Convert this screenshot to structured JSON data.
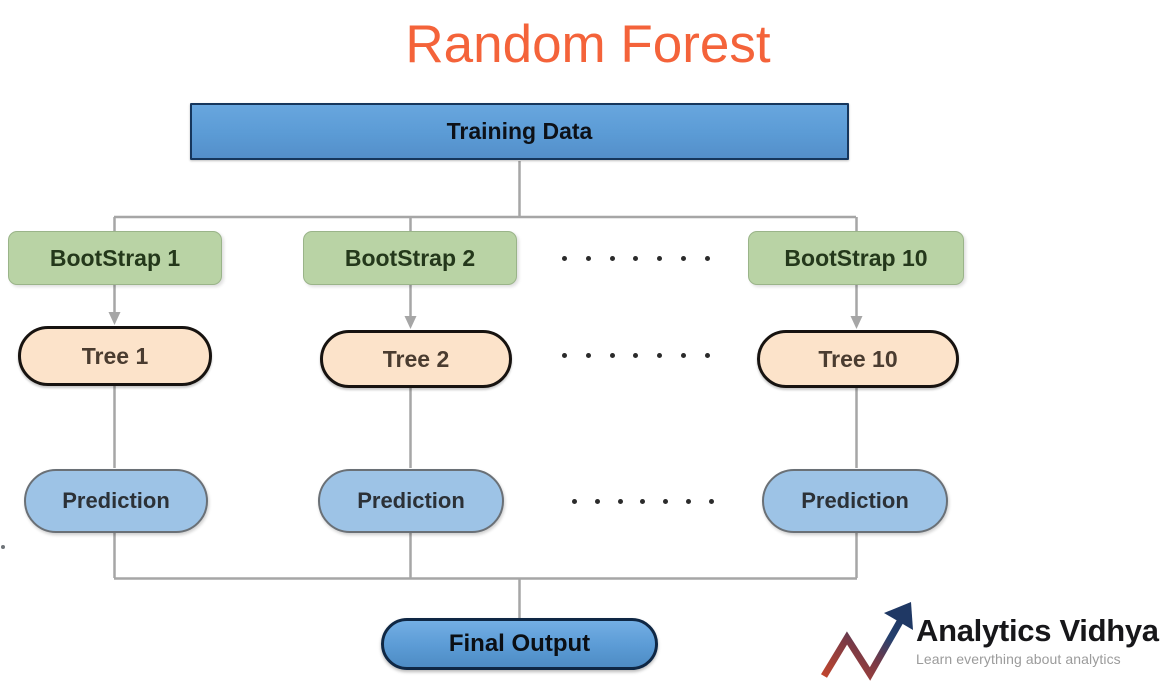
{
  "page": {
    "title": "Random Forest",
    "title_color": "#f4633a",
    "background": "#ffffff"
  },
  "diagram": {
    "root": {
      "label": "Training Data",
      "fill": "#5b9bd5",
      "border": "#16365c"
    },
    "columns": [
      {
        "bootstrap": "BootStrap 1",
        "tree": "Tree 1",
        "prediction": "Prediction"
      },
      {
        "bootstrap": "BootStrap 2",
        "tree": "Tree 2",
        "prediction": "Prediction"
      },
      {
        "bootstrap": "BootStrap 10",
        "tree": "Tree 10",
        "prediction": "Prediction"
      }
    ],
    "ellipsis": {
      "dot_count": 7,
      "rows": [
        "bootstrap-row",
        "tree-row",
        "prediction-row"
      ]
    },
    "final": {
      "label": "Final Output",
      "fill": "#5b9bd5",
      "border": "#0f2744"
    },
    "colors": {
      "bootstrap_fill": "#b9d3a5",
      "bootstrap_border": "#9ab489",
      "tree_fill": "#fce3ca",
      "tree_border": "#171310",
      "prediction_fill": "#9dc3e6",
      "prediction_border": "#6a7076",
      "connector": "#a6a6a6"
    }
  },
  "logo": {
    "name": "Analytics Vidhya",
    "tagline": "Learn everything about analytics",
    "mark_color_start": "#c0452e",
    "mark_color_end": "#1f3864"
  }
}
